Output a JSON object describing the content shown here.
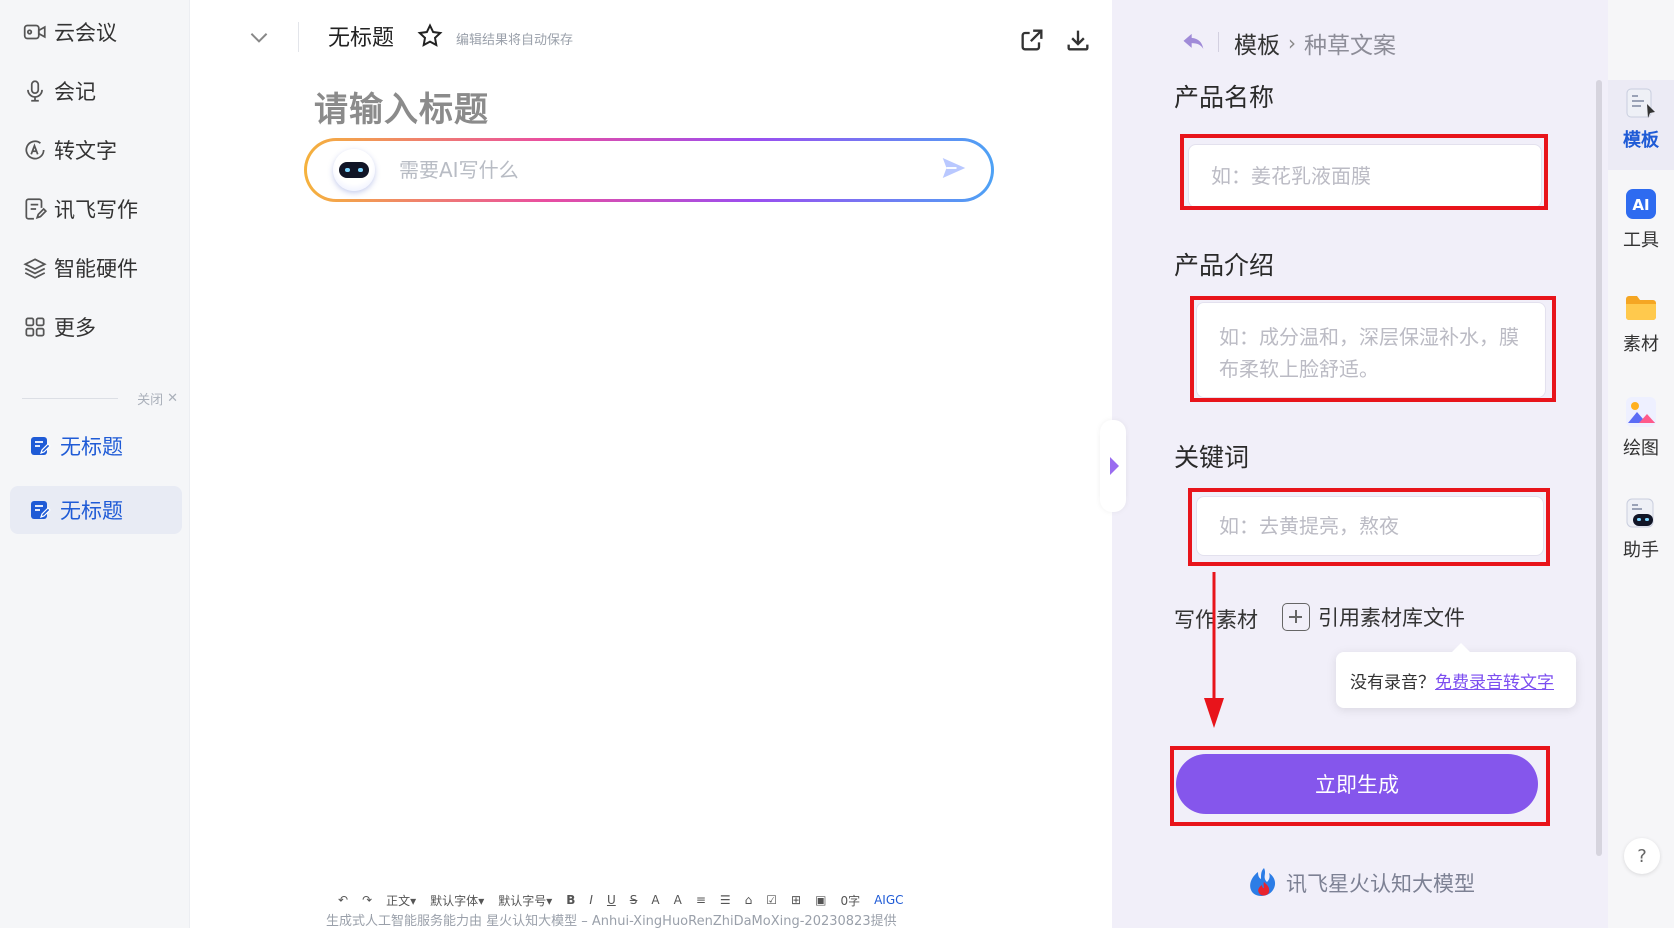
{
  "sidebar": {
    "nav": [
      {
        "label": "云会议",
        "icon": "video-camera-icon"
      },
      {
        "label": "会记",
        "icon": "microphone-icon"
      },
      {
        "label": "转文字",
        "icon": "text-convert-icon"
      },
      {
        "label": "讯飞写作",
        "icon": "write-doc-icon"
      },
      {
        "label": "智能硬件",
        "icon": "layers-icon"
      },
      {
        "label": "更多",
        "icon": "grid-icon"
      }
    ],
    "close_label": "关闭",
    "docs": [
      {
        "label": "无标题",
        "icon": "document-edit-icon"
      },
      {
        "label": "无标题",
        "icon": "document-edit-icon"
      }
    ]
  },
  "editor": {
    "doc_title": "无标题",
    "autosave": "编辑结果将自动保存",
    "heading_placeholder": "请输入标题",
    "ai_placeholder": "需要AI写什么",
    "toolbar": [
      "正文",
      "默认字体",
      "默认字号",
      "B",
      "I",
      "U",
      "S",
      "A",
      "A",
      "≡",
      "☰",
      "⌂",
      "☑",
      "⊞",
      "▣",
      "0字",
      "AIGC"
    ],
    "footer": "生成式人工智能服务能力由 星火认知大模型 – Anhui-XingHuoRenZhiDaMoXing-20230823提供"
  },
  "panel": {
    "breadcrumb_root": "模板",
    "breadcrumb_current": "种草文案",
    "fields": [
      {
        "label": "产品名称",
        "placeholder": "如：姜花乳液面膜"
      },
      {
        "label": "产品介绍",
        "placeholder": "如：成分温和，深层保湿补水，膜布柔软上脸舒适。"
      },
      {
        "label": "关键词",
        "placeholder": "如：去黄提亮，熬夜"
      }
    ],
    "material_label": "写作素材",
    "cite_label": "引用素材库文件",
    "tooltip_text": "没有录音？",
    "tooltip_link": "免费录音转文字",
    "generate_label": "立即生成",
    "brand": "讯飞星火认知大模型"
  },
  "rail": {
    "items": [
      {
        "label": "模板",
        "icon": "template-icon"
      },
      {
        "label": "工具",
        "icon": "ai-tool-icon"
      },
      {
        "label": "素材",
        "icon": "folder-icon"
      },
      {
        "label": "绘图",
        "icon": "picture-icon"
      },
      {
        "label": "助手",
        "icon": "assistant-robot-icon"
      }
    ],
    "help": "?"
  },
  "colors": {
    "accent_purple": "#8556ec",
    "active_blue": "#1f5bd6",
    "highlight_red": "#e8141b"
  }
}
